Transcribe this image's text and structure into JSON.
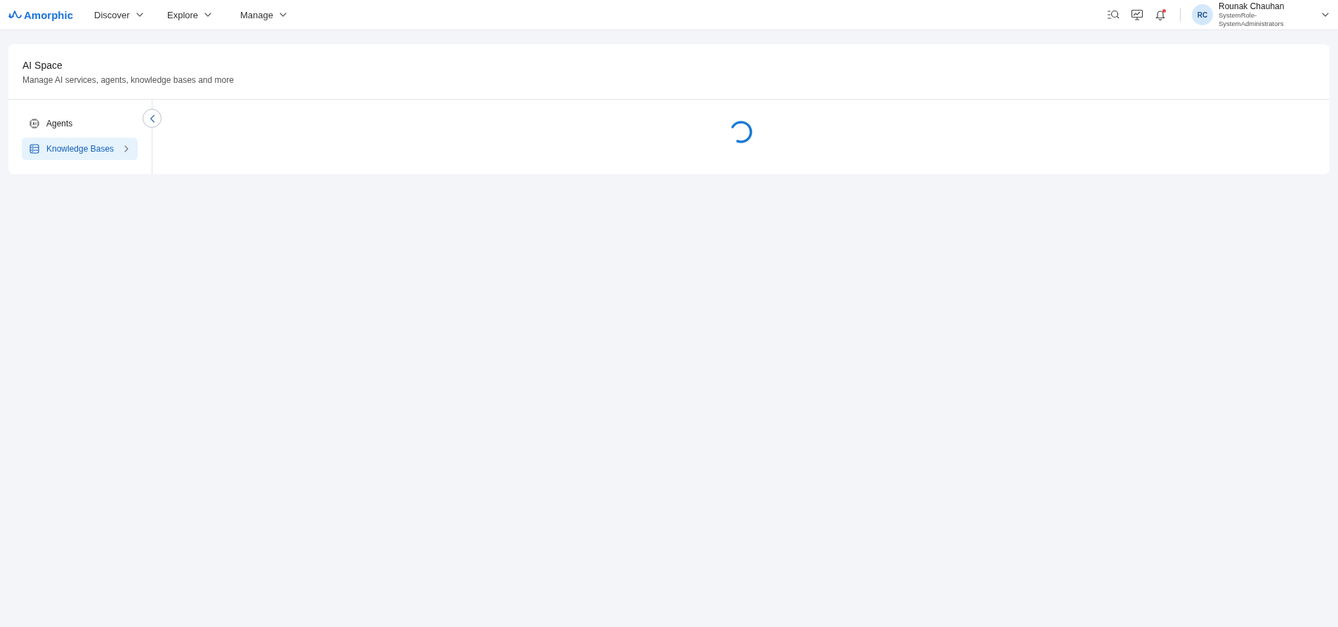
{
  "brand": {
    "name": "Amorphic"
  },
  "nav": [
    {
      "label": "Discover"
    },
    {
      "label": "Explore"
    },
    {
      "label": "Manage"
    }
  ],
  "notifications": {
    "unread": true
  },
  "user": {
    "initials": "RC",
    "name": "Rounak Chauhan",
    "role": "SystemRole-SystemAdministrators"
  },
  "page": {
    "title": "AI Space",
    "subtitle": "Manage AI services, agents, knowledge bases and more"
  },
  "sidebar": {
    "collapsed": false,
    "items": [
      {
        "kind": "agents",
        "label": "Agents",
        "selected": false
      },
      {
        "kind": "knowledge",
        "label": "Knowledge Bases",
        "selected": true
      }
    ]
  },
  "content": {
    "loading": true
  }
}
